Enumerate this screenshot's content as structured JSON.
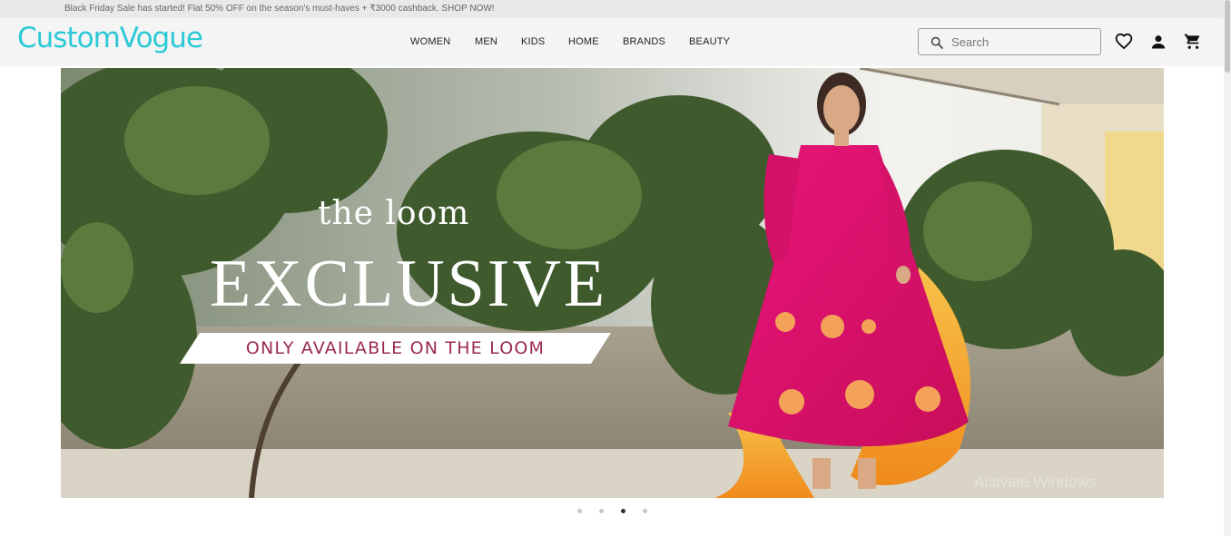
{
  "announcement": "Black Friday Sale has started! Flat 50% OFF on the season's must-haves + ₹3000 cashback. SHOP NOW!",
  "logo": "CustomVogue",
  "nav": [
    "WOMEN",
    "MEN",
    "KIDS",
    "HOME",
    "BRANDS",
    "BEAUTY"
  ],
  "search": {
    "placeholder": "Search",
    "value": ""
  },
  "header_icons": [
    "wishlist-heart-icon",
    "account-person-icon",
    "shopping-cart-icon"
  ],
  "hero": {
    "brand": "the loom",
    "headline": "EXCLUSIVE",
    "tagline": "ONLY AVAILABLE ON THE LOOM",
    "watermark": "Activate Windows"
  },
  "carousel": {
    "slide_count": 4,
    "active_index": 2
  },
  "colors": {
    "logo": "#2cc9d6",
    "announcement_bg": "#e9e9e9",
    "header_bg": "#f4f4f4",
    "tagline_text": "#9b2a55",
    "dress_pink": "#e0126b",
    "dupatta_orange": "#f5a623"
  }
}
